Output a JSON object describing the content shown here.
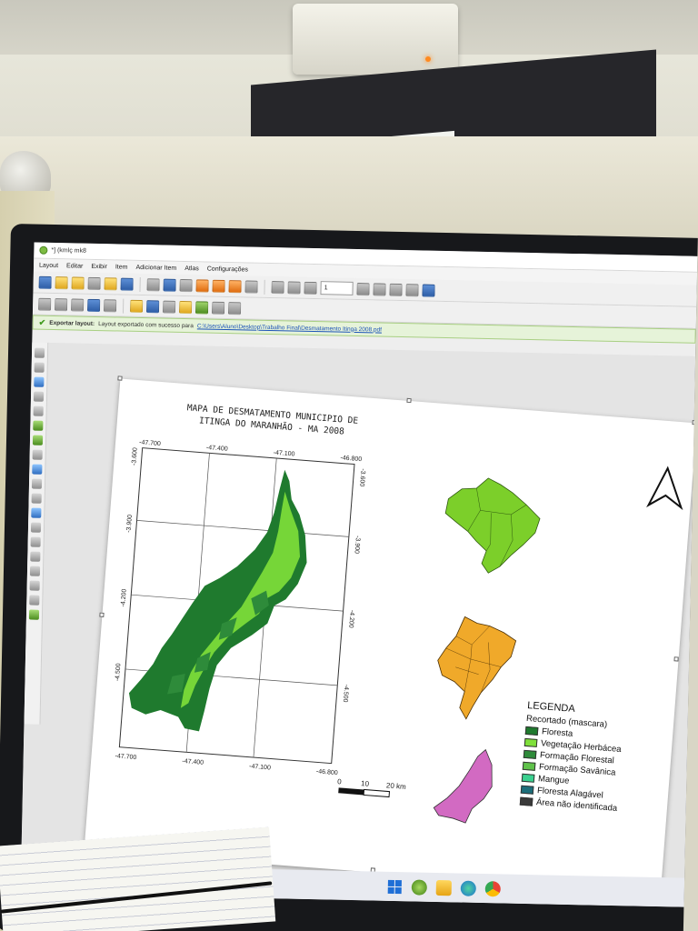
{
  "window": {
    "title": "*] (kmlç mk8"
  },
  "menu": [
    "Layout",
    "Editar",
    "Exibir",
    "Item",
    "Adicionar Item",
    "Atlas",
    "Configurações"
  ],
  "toolbar": {
    "page_value": "1"
  },
  "message": {
    "title": "Exportar layout:",
    "text": "Layout exportado com sucesso para",
    "path": "C:\\Users\\Aluno\\Desktop\\Trabalho Final\\Desmatamento Itinga 2008.pdf"
  },
  "map": {
    "title_line1": "MAPA DE DESMATAMENTO MUNICIPIO DE",
    "title_line2": "ITINGA DO MARANHÃO - MA 2008",
    "top_ticks": [
      "-47.700",
      "-47.400",
      "-47.100",
      "-46.800"
    ],
    "bottom_ticks": [
      "-47.700",
      "-47.400",
      "-47.100",
      "-46.800"
    ],
    "left_ticks": [
      "-3.600",
      "-3.900",
      "-4.200",
      "-4.500"
    ],
    "right_ticks": [
      "-3.600",
      "-3.900",
      "-4.200",
      "-4.500"
    ],
    "scalebar": {
      "labels": [
        "0",
        "10",
        "20 km"
      ]
    }
  },
  "legend": {
    "title": "LEGENDA",
    "subtitle": "Recortado (mascara)",
    "items": [
      {
        "label": "Floresta",
        "color": "#1f7a2e"
      },
      {
        "label": "Vegetação Herbácea",
        "color": "#7fe03a"
      },
      {
        "label": "Formação Florestal",
        "color": "#2e8b3a"
      },
      {
        "label": "Formação Savânica",
        "color": "#5fc24a"
      },
      {
        "label": "Mangue",
        "color": "#3ad18f"
      },
      {
        "label": "Floresta Alagável",
        "color": "#1c6e7a"
      },
      {
        "label": "Área não identificada",
        "color": "#3a3a3a"
      }
    ]
  },
  "colors": {
    "brazil": "#7ccf2a",
    "maranhao": "#f0a92a",
    "itinga": "#d26ac2",
    "forest_dark": "#1f7a2e",
    "forest_light": "#7fe03a"
  },
  "taskbar": {
    "icons": [
      "windows-icon",
      "qgis-icon",
      "file-explorer-icon",
      "edge-icon",
      "chrome-icon"
    ]
  }
}
